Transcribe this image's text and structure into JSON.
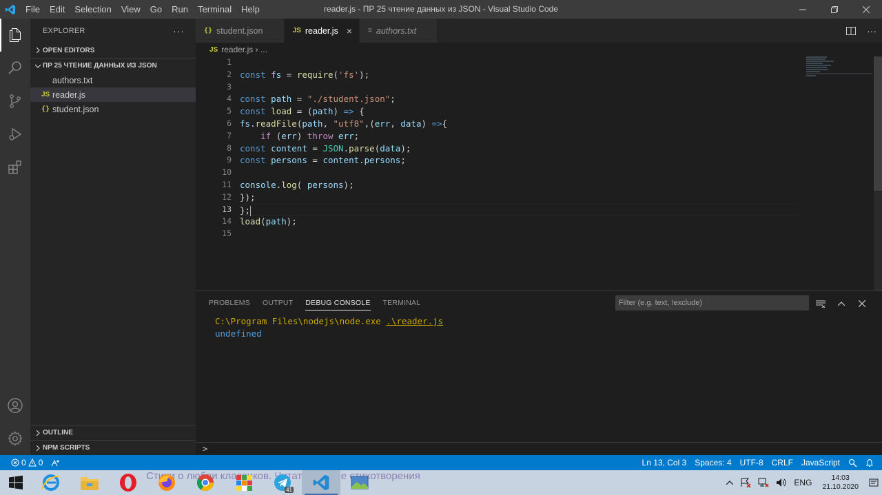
{
  "window": {
    "title": "reader.js - ПР 25 чтение данных из JSON - Visual Studio Code",
    "menu": [
      "File",
      "Edit",
      "Selection",
      "View",
      "Go",
      "Run",
      "Terminal",
      "Help"
    ]
  },
  "sidebar": {
    "header": "EXPLORER",
    "open_editors": "OPEN EDITORS",
    "folder": "ПР 25 ЧТЕНИЕ ДАННЫХ ИЗ JSON",
    "files": [
      {
        "name": "authors.txt",
        "icon": "text-file-icon",
        "selected": false
      },
      {
        "name": "reader.js",
        "icon": "js-file-icon",
        "selected": true
      },
      {
        "name": "student.json",
        "icon": "json-file-icon",
        "selected": false
      }
    ],
    "outline": "OUTLINE",
    "npm_scripts": "NPM SCRIPTS"
  },
  "tabs": [
    {
      "label": "student.json",
      "icon": "{}",
      "active": false,
      "italic": false
    },
    {
      "label": "reader.js",
      "icon": "JS",
      "active": true,
      "italic": false
    },
    {
      "label": "authors.txt",
      "icon": "≡",
      "active": false,
      "italic": true
    }
  ],
  "breadcrumb": {
    "icon": "JS",
    "file": "reader.js",
    "rest": "› ..."
  },
  "editor": {
    "line_numbers": [
      "1",
      "2",
      "3",
      "4",
      "5",
      "6",
      "7",
      "8",
      "9",
      "10",
      "11",
      "12",
      "13",
      "14",
      "15"
    ],
    "current_line": 13
  },
  "panel": {
    "tabs": [
      "PROBLEMS",
      "OUTPUT",
      "DEBUG CONSOLE",
      "TERMINAL"
    ],
    "active_tab": "DEBUG CONSOLE",
    "filter_placeholder": "Filter (e.g. text, !exclude)",
    "console": {
      "command": "C:\\Program Files\\nodejs\\node.exe ",
      "script": ".\\reader.js",
      "output": "undefined"
    },
    "repl_prompt": ">"
  },
  "statusbar": {
    "errors": "0",
    "warnings": "0",
    "position": "Ln 13, Col 3",
    "spaces": "Spaces: 4",
    "encoding": "UTF-8",
    "eol": "CRLF",
    "language": "JavaScript",
    "accent": "#007acc"
  },
  "taskbar": {
    "ghost_text": "Стихи о любви классиков. Читать лучшие стихотворения",
    "telegram_badge": "41",
    "language": "ENG",
    "time": "14:03",
    "date": "21.10.2020"
  }
}
